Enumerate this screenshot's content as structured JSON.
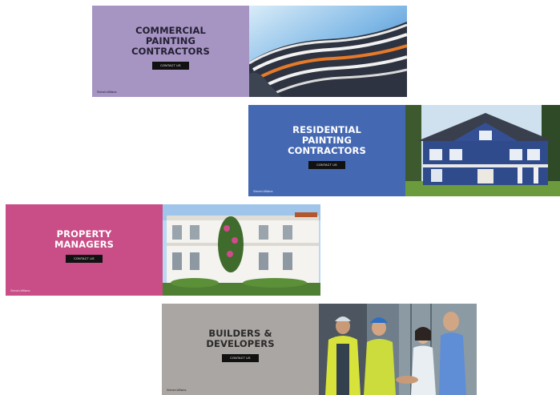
{
  "banners": [
    {
      "title": "COMMERCIAL\nPAINTING\nCONTRACTORS",
      "cta": "CONTACT US",
      "footnote": "Sherwin-Williams"
    },
    {
      "title": "RESIDENTIAL\nPAINTING\nCONTRACTORS",
      "cta": "CONTACT US",
      "footnote": "Sherwin-Williams"
    },
    {
      "title": "PROPERTY\nMANAGERS",
      "cta": "CONTACT US",
      "footnote": "Sherwin-Williams"
    },
    {
      "title": "BUILDERS &\nDEVELOPERS",
      "cta": "CONTACT US",
      "footnote": "Sherwin-Williams"
    }
  ],
  "colors": {
    "commercial": "#a694c3",
    "residential": "#4568b3",
    "property": "#c94d86",
    "builders": "#aaa6a3",
    "cta_background": "#111111"
  },
  "icons": {
    "commercial_photo": "curved-building-photo",
    "residential_photo": "blue-house-photo",
    "property_photo": "white-apartment-photo",
    "builders_photo": "construction-workers-photo"
  }
}
